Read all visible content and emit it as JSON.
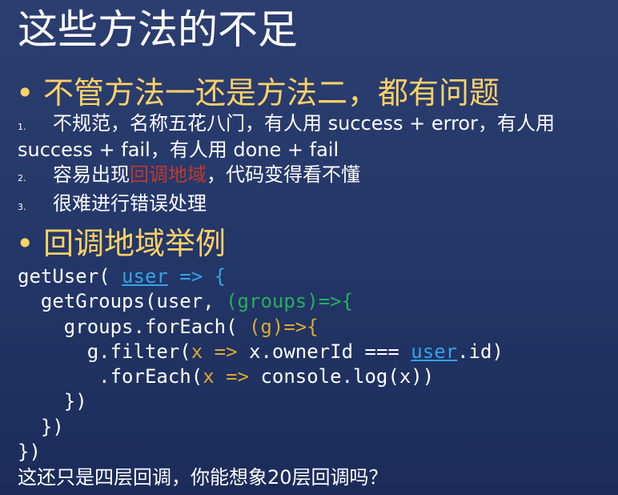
{
  "slide": {
    "title": "这些方法的不足",
    "bullets": [
      {
        "marker": "•",
        "text": "不管方法一还是方法二，都有问题"
      },
      {
        "marker": "•",
        "text": "回调地域举例"
      }
    ],
    "numbered": [
      {
        "num": "1.",
        "text": "不规范，名称五花八门，有人用 success + error，有人用 success + fail，有人用 done + fail"
      },
      {
        "num": "2.",
        "text_before": "容易出现",
        "highlight": "回调地域",
        "text_after": "，代码变得看不懂"
      },
      {
        "num": "3.",
        "text": "很难进行错误处理"
      }
    ],
    "code": {
      "l1a": "getUser( ",
      "l1b": "user",
      "l1c": " => {",
      "l2a": "  getGroups(user, ",
      "l2b": "(groups)=>{",
      "l3a": "    groups.forEach( ",
      "l3b": "(g)=>{",
      "l4a": "      g.filter(",
      "l4b": "x",
      "l4c": " => ",
      "l4d": "x.ownerId === ",
      "l4e": "user",
      "l4f": ".id)",
      "l5a": "       .forEach(",
      "l5b": "x",
      "l5c": " => ",
      "l5d": "console.log(x))",
      "l6": "    })",
      "l7": "  })",
      "l8": "})"
    },
    "footer": "这还只是四层回调，你能想象20层回调吗？"
  }
}
